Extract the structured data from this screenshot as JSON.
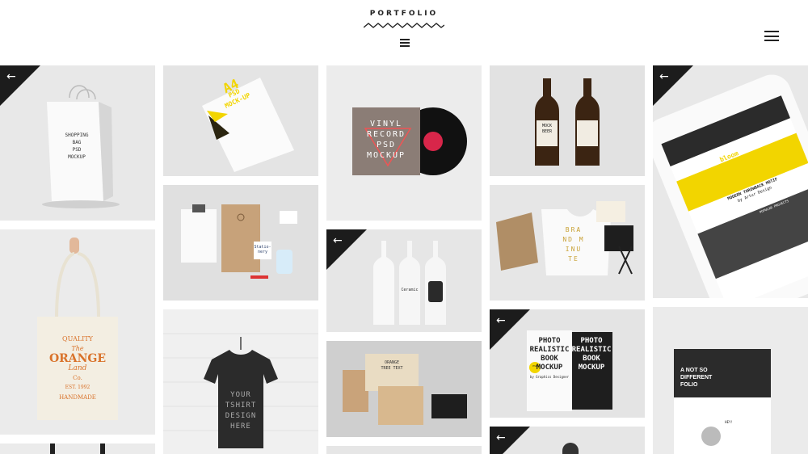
{
  "header": {
    "logo_text": "PORTFOLIO",
    "center_menu_icon": "hamburger-icon",
    "right_menu_icon": "hamburger-icon"
  },
  "colors": {
    "accent": "#f2d500",
    "dark": "#1c1c1c",
    "tile_bg": "#e6e6e6"
  },
  "tiles": {
    "shopping_bag": {
      "arrow": "←",
      "line1": "SHOPPING",
      "line2": "BAG",
      "line3": "PSD",
      "line4": "MOCKUP"
    },
    "letter_a4": {
      "line1": "PSD",
      "line2": "MOCK-UP",
      "badge": "A4"
    },
    "vinyl": {
      "line1": "VINYL",
      "line2": "RECORD",
      "line3": "PSD",
      "line4": "MOCKUP"
    },
    "beer": {
      "label1": "MOCK",
      "label2": "BEER"
    },
    "iphone": {
      "arrow": "←",
      "brand": "bloom",
      "sub": "HOTEL DESIGN",
      "banner": "MODERN THROWBACK MOTIF",
      "byline": "by Artur Design",
      "popular": "POPULAR PROJECTS"
    },
    "tote": {
      "line1": "QUALITY",
      "line2": "The",
      "line3": "ORANGE",
      "line4": "Land",
      "line5": "Co.",
      "line6": "EST. 1992",
      "line7": "HANDMADE"
    },
    "stationery": {
      "card": "Statio-nery"
    },
    "bottles": {
      "arrow": "←",
      "label": "Ceramic"
    },
    "branding": {
      "b1": "BRA",
      "b2": "ND M",
      "b3": "INU",
      "b4": "TE"
    },
    "tshirt": {
      "line1": "YOUR",
      "line2": "TSHIRT",
      "line3": "DESIGN",
      "line4": "HERE"
    },
    "packaging": {
      "label1": "ORANGE",
      "label2": "TREE TEXT"
    },
    "book": {
      "arrow": "←",
      "line1": "PHOTO",
      "line2": "REALISTIC",
      "line3": "BOOK",
      "line4": "MOCKUP",
      "badge": "PSD",
      "byline": "by Graphics Designer",
      "back1": "PHOTO",
      "back2": "REALISTIC",
      "back3": "BOOK",
      "back4": "MOCKUP"
    },
    "folio": {
      "line1": "A NOT SO",
      "line2": "DIFFERENT",
      "line3": "FOLIO",
      "hey": "HEY!"
    },
    "bottom_partial": {
      "arrow": "←"
    }
  }
}
